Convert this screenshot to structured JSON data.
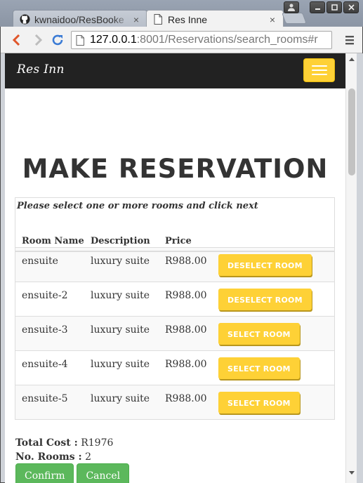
{
  "browser": {
    "tabs": [
      {
        "title": "kwnaidoo/ResBooke",
        "close": "×"
      },
      {
        "title": "Res Inne",
        "close": "×"
      }
    ],
    "url_host": "127.0.0.1",
    "url_path": ":8001/Reservations/search_rooms#r"
  },
  "site": {
    "brand": "Res Inn",
    "accent": "#fed136"
  },
  "page": {
    "heading": "MAKE RESERVATION",
    "instruction": "Please select one or more rooms and click next",
    "columns": [
      "Room Name",
      "Description",
      "Price"
    ],
    "rooms": [
      {
        "name": "ensuite",
        "description": "luxury suite",
        "price": "R988.00",
        "action": "DESELECT ROOM"
      },
      {
        "name": "ensuite-2",
        "description": "luxury suite",
        "price": "R988.00",
        "action": "DESELECT ROOM"
      },
      {
        "name": "ensuite-3",
        "description": "luxury suite",
        "price": "R988.00",
        "action": "SELECT ROOM"
      },
      {
        "name": "ensuite-4",
        "description": "luxury suite",
        "price": "R988.00",
        "action": "SELECT ROOM"
      },
      {
        "name": "ensuite-5",
        "description": "luxury suite",
        "price": "R988.00",
        "action": "SELECT ROOM"
      }
    ],
    "total_cost_label": "Total Cost :",
    "total_cost_value": "R1976",
    "no_rooms_label": "No. Rooms :",
    "no_rooms_value": "2",
    "confirm_label": "Confirm",
    "cancel_label": "Cancel"
  }
}
